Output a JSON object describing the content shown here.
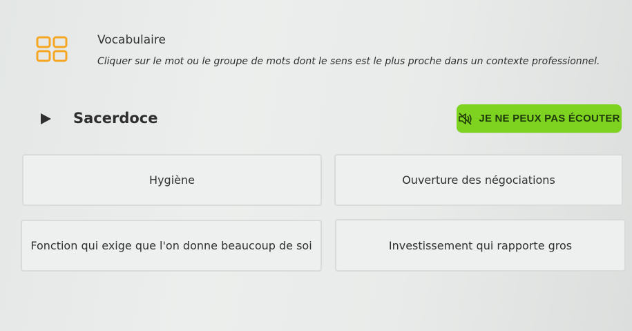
{
  "header": {
    "title": "Vocabulaire",
    "instruction": "Cliquer sur le mot ou le groupe de mots dont le sens est le plus proche dans un contexte professionnel."
  },
  "question": {
    "word": "Sacerdoce"
  },
  "listen_button": {
    "label": "JE NE PEUX PAS ÉCOUTER"
  },
  "options": [
    {
      "label": "Hygiène"
    },
    {
      "label": "Ouverture des négociations"
    },
    {
      "label": "Fonction qui exige que l'on donne beaucoup de soi"
    },
    {
      "label": "Investissement qui rapporte gros"
    }
  ],
  "colors": {
    "accent_green": "#7ed321",
    "icon_orange": "#f5a623"
  },
  "icons": {
    "header": "vocabulary-grid-icon",
    "play": "play-icon",
    "listen": "speaker-muted-icon"
  }
}
